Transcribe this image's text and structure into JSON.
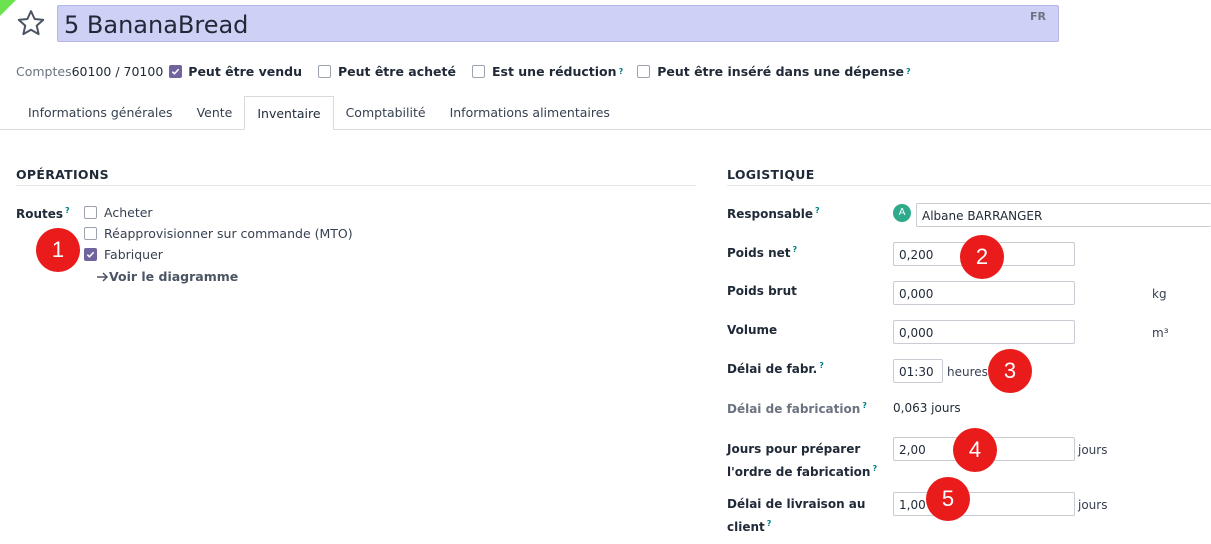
{
  "header": {
    "title": "5 BananaBread",
    "lang": "FR"
  },
  "options": {
    "accounts_label": "Comptes",
    "accounts_value": "60100 / 70100",
    "can_sell": "Peut être vendu",
    "can_purchase": "Peut être acheté",
    "is_discount": "Est une réduction",
    "in_expense": "Peut être inséré dans une dépense",
    "help": "?"
  },
  "tabs": [
    {
      "label": "Informations générales"
    },
    {
      "label": "Vente"
    },
    {
      "label": "Inventaire"
    },
    {
      "label": "Comptabilité"
    },
    {
      "label": "Informations alimentaires"
    }
  ],
  "operations": {
    "title": "OPÉRATIONS",
    "routes_label": "Routes",
    "routes": [
      {
        "label": "Acheter",
        "checked": false
      },
      {
        "label": "Réapprovisionner sur commande (MTO)",
        "checked": false
      },
      {
        "label": "Fabriquer",
        "checked": true
      }
    ],
    "diagram_link": "Voir le diagramme"
  },
  "logistics": {
    "title": "LOGISTIQUE",
    "responsible_label": "Responsable",
    "responsible_avatar": "A",
    "responsible_value": "Albane BARRANGER",
    "net_weight_label": "Poids net",
    "net_weight_value": "0,200",
    "gross_weight_label": "Poids brut",
    "gross_weight_value": "0,000",
    "weight_unit": "kg",
    "volume_label": "Volume",
    "volume_value": "0,000",
    "volume_unit": "m³",
    "mfg_delay_label": "Délai de fabr.",
    "mfg_delay_value": "01:30",
    "mfg_delay_unit": "heures",
    "mfg_delay_days_label": "Délai de fabrication",
    "mfg_delay_days_value": "0,063 jours",
    "prep_days_label_1": "Jours pour préparer",
    "prep_days_label_2": "l'ordre de fabrication",
    "prep_days_value": "2,00",
    "prep_days_unit": "jours",
    "delivery_label_1": "Délai de livraison au",
    "delivery_label_2": "client",
    "delivery_value": "1,00",
    "delivery_unit": "jours"
  },
  "markers": [
    "1",
    "2",
    "3",
    "4",
    "5"
  ]
}
